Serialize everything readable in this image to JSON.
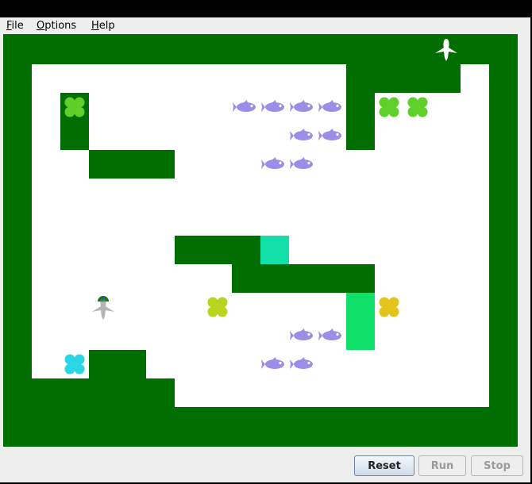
{
  "menu": {
    "items": [
      {
        "name": "menu-file",
        "mnemonic": "F",
        "rest": "ile"
      },
      {
        "name": "menu-options",
        "mnemonic": "O",
        "rest": "ptions"
      },
      {
        "name": "menu-help",
        "mnemonic": "H",
        "rest": "elp"
      }
    ]
  },
  "board": {
    "columns": 18,
    "rows": 14,
    "cell_size_label": "36",
    "counter": "1",
    "colors": {
      "wall": "#006e00",
      "floor": "#ffffff",
      "fish": "#9b8ee8",
      "flower_green": "#5fcf2a",
      "flower_lime": "#b9d41c",
      "flower_yellow": "#e2c41a",
      "flower_cyan": "#2ad6e6",
      "tile_teal": "#12e0a8",
      "tile_green": "#0fe06a",
      "player": "#b5b5b5"
    },
    "walls": [
      [
        2,
        2
      ],
      [
        2,
        3
      ],
      [
        3,
        4
      ],
      [
        4,
        4
      ],
      [
        5,
        4
      ],
      [
        12,
        1
      ],
      [
        13,
        1
      ],
      [
        14,
        1
      ],
      [
        15,
        1
      ],
      [
        12,
        2
      ],
      [
        12,
        3
      ],
      [
        6,
        7
      ],
      [
        7,
        7
      ],
      [
        8,
        7
      ],
      [
        8,
        8
      ],
      [
        9,
        8
      ],
      [
        10,
        8
      ],
      [
        11,
        8
      ],
      [
        12,
        8
      ],
      [
        0,
        11
      ],
      [
        3,
        11
      ],
      [
        4,
        11
      ],
      [
        0,
        12
      ],
      [
        1,
        12
      ],
      [
        2,
        12
      ],
      [
        3,
        12
      ],
      [
        4,
        12
      ],
      [
        5,
        12
      ]
    ],
    "floor_rect": {
      "c0": 1,
      "r0": 1,
      "c1": 16,
      "r1": 12
    },
    "floor_extra": [],
    "tiles": [
      {
        "col": 9,
        "row": 7,
        "rows": 1,
        "kind": "teal"
      },
      {
        "col": 12,
        "row": 9,
        "rows": 2,
        "kind": "green"
      }
    ],
    "fish": [
      [
        8,
        2
      ],
      [
        9,
        2
      ],
      [
        10,
        2
      ],
      [
        11,
        2
      ],
      [
        10,
        3
      ],
      [
        11,
        3
      ],
      [
        9,
        4
      ],
      [
        10,
        4
      ],
      [
        10,
        10
      ],
      [
        11,
        10
      ],
      [
        9,
        11
      ],
      [
        10,
        11
      ]
    ],
    "flowers": [
      {
        "col": 2,
        "row": 2,
        "color": "flower_green"
      },
      {
        "col": 13,
        "row": 2,
        "color": "flower_green"
      },
      {
        "col": 14,
        "row": 2,
        "color": "flower_green"
      },
      {
        "col": 7,
        "row": 9,
        "color": "flower_lime"
      },
      {
        "col": 13,
        "row": 9,
        "color": "flower_yellow"
      },
      {
        "col": 2,
        "row": 11,
        "color": "flower_cyan"
      }
    ],
    "player": {
      "col": 3,
      "row": 9
    },
    "goal_bird": {
      "col": 15,
      "row": 0
    }
  },
  "buttons": {
    "reset": "Reset",
    "run": "Run",
    "stop": "Stop"
  }
}
